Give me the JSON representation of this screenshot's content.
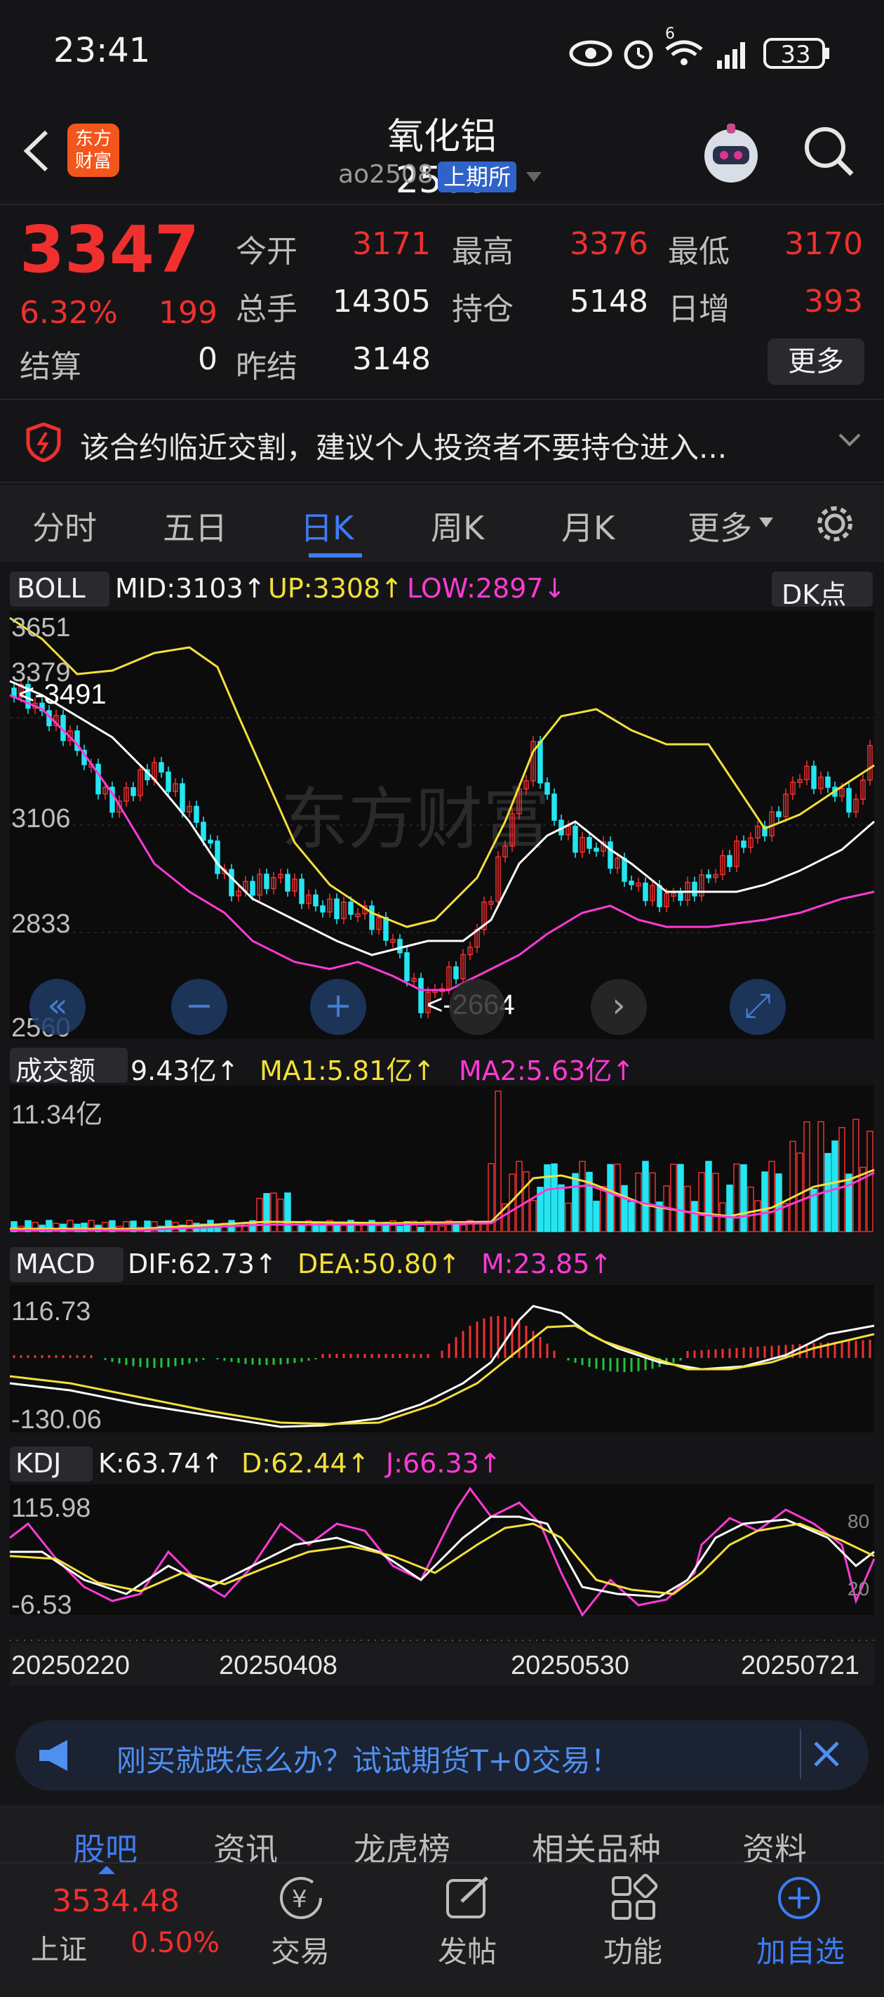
{
  "status": {
    "time": "23:41",
    "battery": "33",
    "signal_super": "6"
  },
  "header": {
    "logo_text": "东方财富",
    "title": "氧化铝2508",
    "code": "ao2508",
    "exchange": "上期所"
  },
  "quote": {
    "price": "3347",
    "change_pct": "6.32%",
    "change": "199",
    "fields": [
      {
        "label": "今开",
        "value": "3171"
      },
      {
        "label": "最高",
        "value": "3376"
      },
      {
        "label": "最低",
        "value": "3170"
      },
      {
        "label": "总手",
        "value": "14305"
      },
      {
        "label": "持仓",
        "value": "5148"
      },
      {
        "label": "日增",
        "value": "393"
      },
      {
        "label": "结算",
        "value": "0"
      },
      {
        "label": "昨结",
        "value": "3148"
      }
    ],
    "more": "更多"
  },
  "notice": {
    "text": "该合约临近交割，建议个人投资者不要持仓进入..."
  },
  "tabs": [
    "分时",
    "五日",
    "日K",
    "周K",
    "月K",
    "更多"
  ],
  "active_tab": "日K",
  "boll": {
    "name": "BOLL",
    "mid": "MID:3103↑",
    "up": "UP:3308↑",
    "low": "LOW:2897↓",
    "dk": "DK点"
  },
  "kaxis": {
    "t1": "3651",
    "t2": "3379",
    "t3": "3106",
    "t4": "2833",
    "t5": "2560",
    "hi": "<-3491",
    "lo": "<-2664"
  },
  "watermark": "东方财富",
  "vol": {
    "name": "成交额",
    "val": "9.43亿↑",
    "ma1": "MA1:5.81亿↑",
    "ma2": "MA2:5.63亿↑",
    "max": "11.34亿"
  },
  "macd": {
    "name": "MACD",
    "dif": "DIF:62.73↑",
    "dea": "DEA:50.80↑",
    "m": "M:23.85↑",
    "top": "116.73",
    "bottom": "-130.06"
  },
  "kdj": {
    "name": "KDJ",
    "k": "K:63.74↑",
    "d": "D:62.44↑",
    "j": "J:66.33↑",
    "top": "115.98",
    "bottom": "-6.53",
    "l80": "80",
    "l20": "20"
  },
  "dates": [
    "20250220",
    "20250408",
    "20250530",
    "20250721"
  ],
  "promo": {
    "text": "刚买就跌怎么办？试试期货T+0交易！"
  },
  "sub_tabs": [
    "股吧",
    "资讯",
    "龙虎榜",
    "相关品种",
    "资料"
  ],
  "index": {
    "value": "3534.48",
    "name": "上证",
    "pct": "0.50%"
  },
  "bottom_nav": [
    "交易",
    "发帖",
    "功能",
    "加自选"
  ],
  "colors": {
    "up": "#f0302f",
    "down": "#23e6f2",
    "accent": "#3d7cf5",
    "mid": "#ffffff",
    "upper": "#f2e03a",
    "lower": "#ff3ad6"
  }
}
